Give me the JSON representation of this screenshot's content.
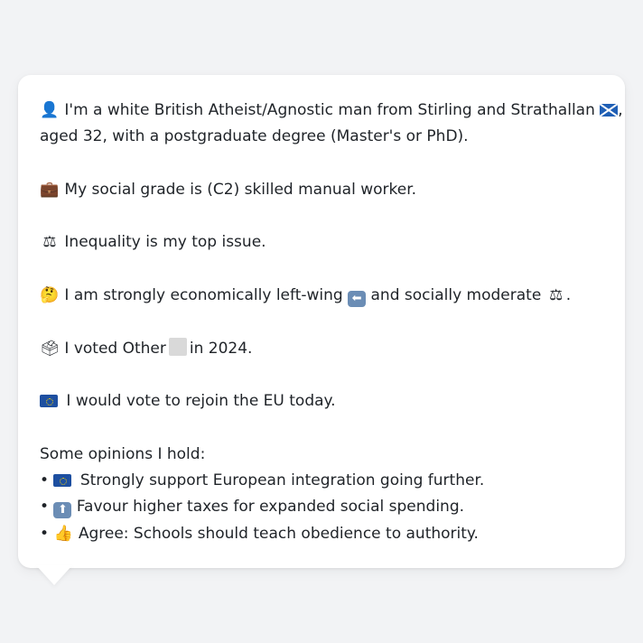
{
  "profile": {
    "intro_line1_pre": "I'm a white British Atheist/Agnostic man from Stirling and Strathallan",
    "intro_line1_post": ",",
    "intro_line2": "aged 32, with a postgraduate degree (Master's or PhD).",
    "social_grade": "My social grade is (C2) skilled manual worker.",
    "top_issue": "Inequality is my top issue.",
    "ideology_pre": "I am strongly economically left-wing",
    "ideology_mid": "and socially moderate",
    "ideology_post": ".",
    "vote_pre": "I voted Other",
    "vote_post": "in 2024.",
    "eu_vote": "I would vote to rejoin the EU today."
  },
  "opinions": {
    "heading": "Some opinions I hold:",
    "items": [
      "Strongly support European integration going further.",
      "Favour higher taxes for expanded social spending.",
      "Agree: Schools should teach obedience to authority."
    ]
  },
  "icons": {
    "person": "bust-in-silhouette-icon",
    "briefcase": "briefcase-icon",
    "scales": "balance-scale-icon",
    "thinking": "thinking-face-icon",
    "ballot": "ballot-box-icon",
    "eu_flag": "eu-flag-icon",
    "scotland_flag": "scotland-flag-icon",
    "left_arrow": "left-arrow-icon",
    "up_arrow": "up-arrow-icon",
    "thumbs_up": "thumbs-up-icon"
  },
  "colors": {
    "background": "#f2f3f5",
    "bubble": "#ffffff",
    "text": "#1f2328",
    "eu_blue": "#1d4fa0",
    "arrow_box": "#6b8db5"
  }
}
